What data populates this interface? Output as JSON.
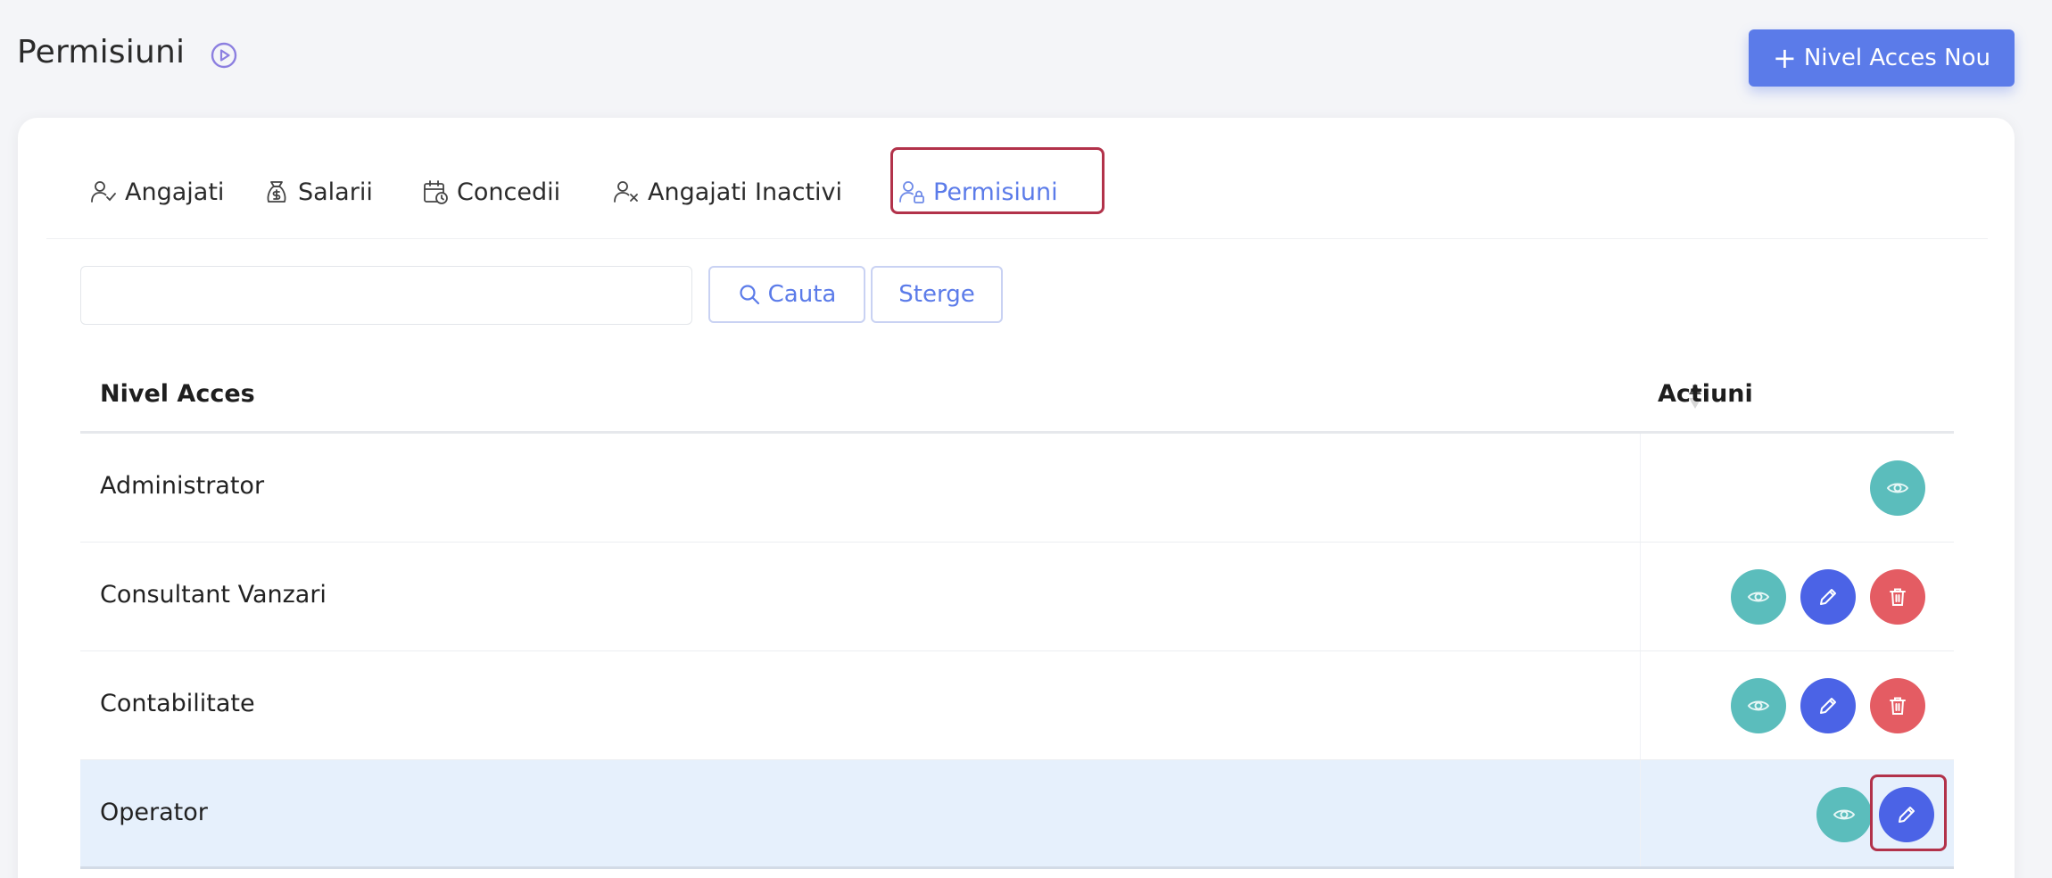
{
  "header": {
    "title": "Permisiuni",
    "new_button_label": "Nivel Acces Nou"
  },
  "tabs": [
    {
      "label": "Angajati",
      "icon": "user-check-icon"
    },
    {
      "label": "Salarii",
      "icon": "money-bag-icon"
    },
    {
      "label": "Concedii",
      "icon": "calendar-clock-icon"
    },
    {
      "label": "Angajati Inactivi",
      "icon": "user-x-icon"
    },
    {
      "label": "Permisiuni",
      "icon": "user-lock-icon",
      "active": true
    }
  ],
  "search": {
    "value": "",
    "placeholder": "",
    "search_label": "Cauta",
    "clear_label": "Sterge"
  },
  "table": {
    "columns": [
      "Nivel Acces",
      "Actiuni"
    ],
    "rows": [
      {
        "label": "Administrator",
        "actions": [
          "view"
        ]
      },
      {
        "label": "Consultant Vanzari",
        "actions": [
          "view",
          "edit",
          "delete"
        ]
      },
      {
        "label": "Contabilitate",
        "actions": [
          "view",
          "edit",
          "delete"
        ]
      },
      {
        "label": "Operator",
        "actions": [
          "view",
          "edit"
        ],
        "selected": true
      }
    ]
  },
  "colors": {
    "primary": "#5b7be9",
    "view": "#5bbdbc",
    "edit": "#4b63e6",
    "delete": "#e45c63",
    "highlight": "#b2324a"
  }
}
